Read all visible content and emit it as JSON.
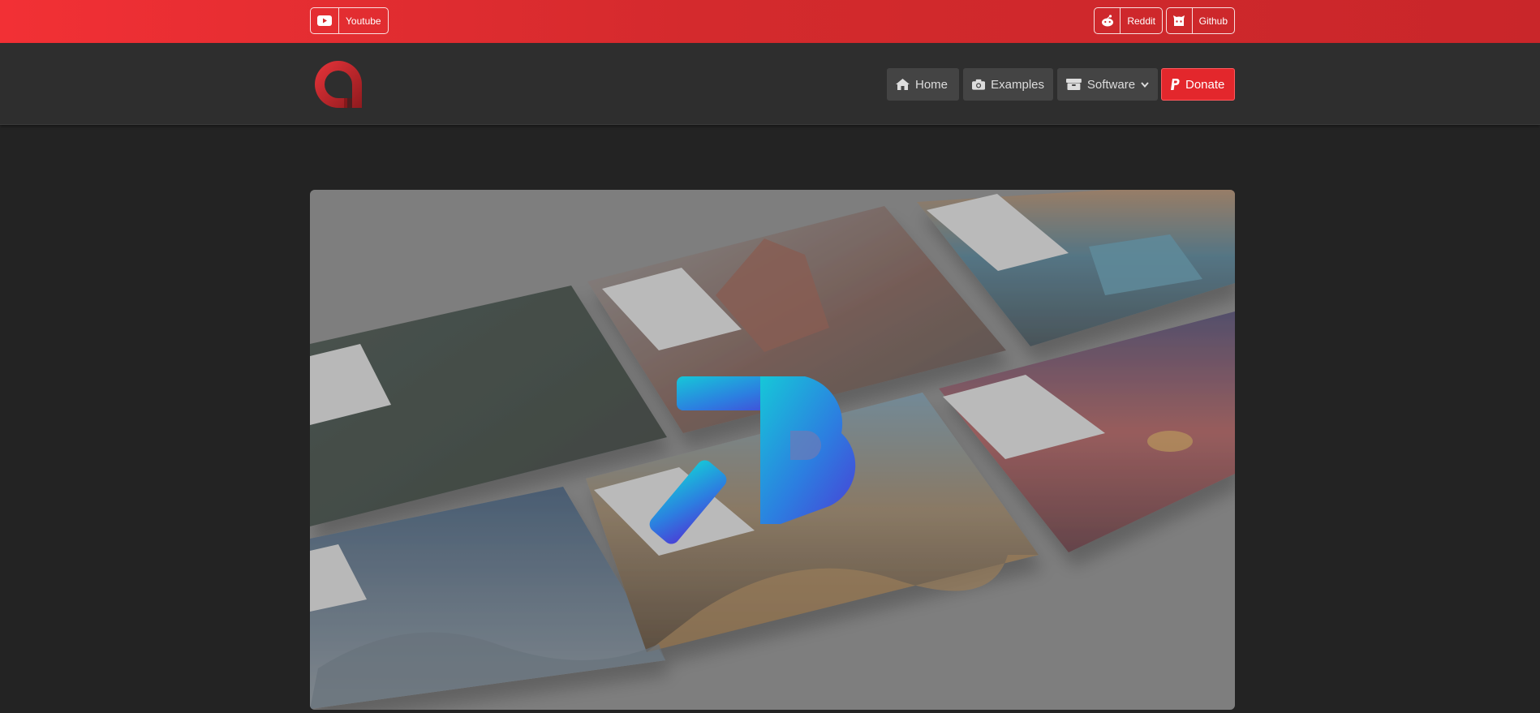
{
  "topbar": {
    "youtube": {
      "label": "Youtube",
      "icon": "youtube-icon"
    },
    "reddit": {
      "label": "Reddit",
      "icon": "reddit-icon"
    },
    "github": {
      "label": "Github",
      "icon": "github-icon"
    },
    "accent": "#e52b2f"
  },
  "nav": {
    "logo": "app-logo",
    "home": {
      "label": "Home",
      "icon": "home-icon"
    },
    "examples": {
      "label": "Examples",
      "icon": "camera-icon"
    },
    "software": {
      "label": "Software",
      "icon": "box-icon"
    },
    "donate": {
      "label": "Donate",
      "icon": "paypal-icon"
    }
  },
  "hero": {
    "image": "software-showcase-wallpapers",
    "overlay_logo": "blue-b-logo"
  }
}
